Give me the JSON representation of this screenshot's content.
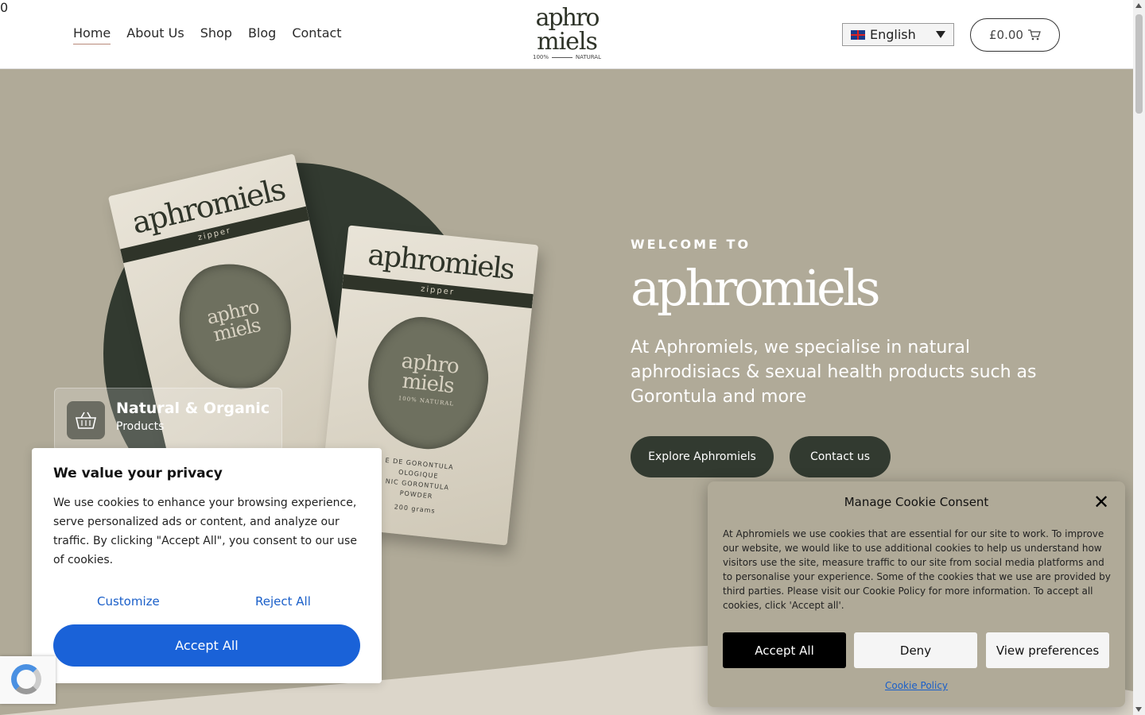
{
  "header": {
    "nav": [
      "Home",
      "About Us",
      "Shop",
      "Blog",
      "Contact"
    ],
    "logo": {
      "line1": "aphro",
      "line2": "miels",
      "tag_left": "100%",
      "tag_right": "NATURAL"
    },
    "language": "English",
    "cart_total": "£0.00",
    "cart_count": "0"
  },
  "hero": {
    "welcome": "WELCOME TO",
    "brand": "aphromiels",
    "description": "At Aphromiels, we specialise in natural aphrodisiacs & sexual health products such as Gorontula and more",
    "buttons": {
      "explore": "Explore Aphromiels",
      "contact": "Contact us"
    },
    "badge": {
      "title": "Natural & Organic",
      "subtitle": "Products"
    },
    "pouch": {
      "brand": "aphromiels",
      "stripe": "zipper",
      "inner_logo_1": "aphro",
      "inner_logo_2": "miels",
      "inner_tag": "100%  NATURAL",
      "desc_1": "E DE GORONTULA",
      "desc_2": "OLOGIQUE",
      "desc_3": "NIC GORONTULA",
      "desc_4": "POWDER",
      "weight": "200 grams"
    }
  },
  "privacy_popup": {
    "title": "We value your privacy",
    "text": "We use cookies to enhance your browsing experience, serve personalized ads or content, and analyze our traffic. By clicking \"Accept All\", you consent to our use of cookies.",
    "customize": "Customize",
    "reject": "Reject All",
    "accept": "Accept All"
  },
  "cookie_consent": {
    "title": "Manage Cookie Consent",
    "close": "✕",
    "body": "At Aphromiels we use cookies that are essential for our site to work. To improve our website, we would like to use additional cookies to help us understand how visitors use the site, measure traffic to our site from social media platforms and to personalise your experience.  Some of the cookies that we use are provided by third parties. Please visit our Cookie Policy for more information. To accept all cookies, click 'Accept all'.",
    "accept": "Accept All",
    "deny": "Deny",
    "view": "View preferences",
    "policy": "Cookie Policy"
  },
  "colors": {
    "hero_bg": "#b0aa98",
    "dark_green": "#323a30",
    "accept_blue": "#1a62d8",
    "link_blue": "#1a5fc9"
  }
}
